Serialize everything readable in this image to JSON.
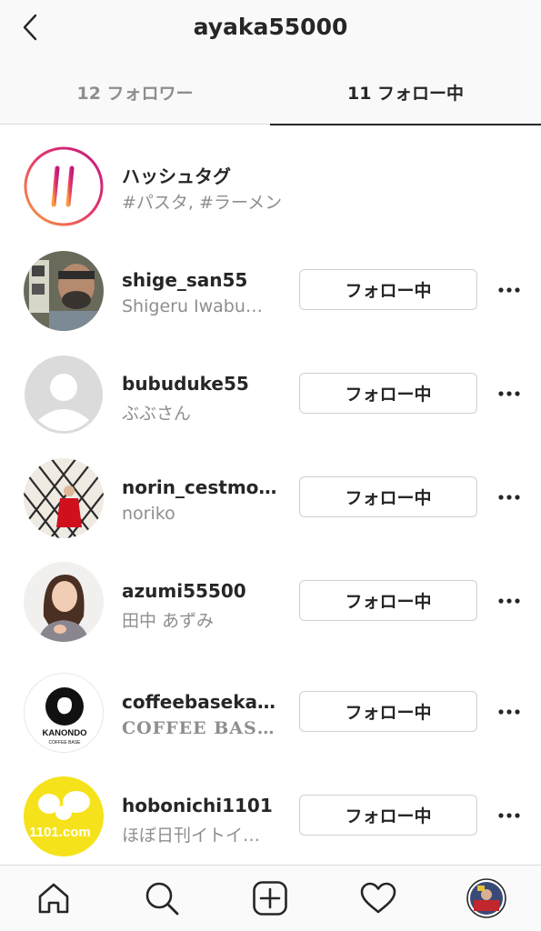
{
  "header": {
    "title": "ayaka55000"
  },
  "tabs": [
    {
      "label": "12 フォロワー",
      "active": false
    },
    {
      "label": "11 フォロー中",
      "active": true
    }
  ],
  "hashtags": {
    "title": "ハッシュタグ",
    "subtitle": "#パスタ, #ラーメン"
  },
  "following": [
    {
      "username": "shige_san55",
      "display_name": "Shigeru Iwabu…",
      "button": "フォロー中"
    },
    {
      "username": "bubuduke55",
      "display_name": "ぶぶさん",
      "button": "フォロー中"
    },
    {
      "username": "norin_cestmo…",
      "display_name": "noriko",
      "button": "フォロー中"
    },
    {
      "username": "azumi55500",
      "display_name": "田中 あずみ",
      "button": "フォロー中"
    },
    {
      "username": "coffeebaseka…",
      "display_name": "COFFEE BAS…",
      "button": "フォロー中"
    },
    {
      "username": "hobonichi1101",
      "display_name": "ほぼ日刊イトイ…",
      "button": "フォロー中"
    }
  ],
  "avatar_logos": {
    "kanondo_name": "KANONDO",
    "kanondo_tag": "COFFEE BASE",
    "hobonichi_text": "1101.com"
  },
  "colors": {
    "text_primary": "#262626",
    "text_secondary": "#8e8e8e",
    "border": "#dbdbdb",
    "hashtag_gradient_start": "#f9a23b",
    "hashtag_gradient_end": "#c2187f",
    "hobonichi_yellow": "#f6e21a"
  },
  "bottom_nav": [
    "home-icon",
    "search-icon",
    "add-post-icon",
    "activity-heart-icon",
    "profile-avatar"
  ]
}
